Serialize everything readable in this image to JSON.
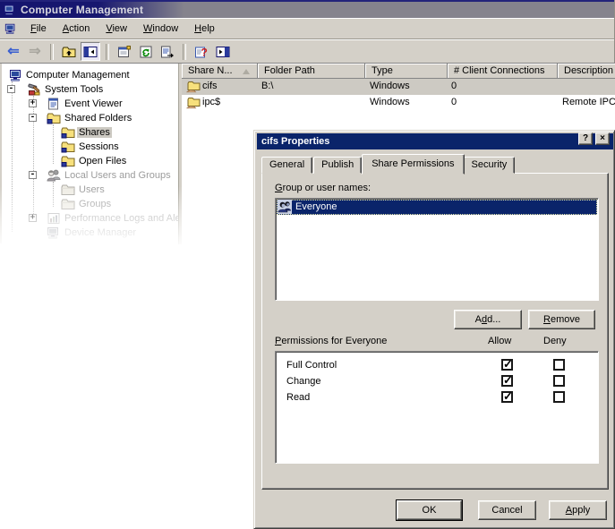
{
  "colors": {
    "accent_navy": "#0a246a",
    "face": "#d4d0c8",
    "title_gradient_left": "#14146e",
    "title_gradient_right": "#85838d",
    "selection_inactive": "#cdcac3"
  },
  "window": {
    "title": "Computer Management",
    "menu": [
      {
        "text": "File",
        "u": 0
      },
      {
        "text": "Action",
        "u": 0
      },
      {
        "text": "View",
        "u": 0
      },
      {
        "text": "Window",
        "u": 0
      },
      {
        "text": "Help",
        "u": 0
      }
    ],
    "toolbar_buttons": [
      "back",
      "forward",
      "up-one-level",
      "show-hide-console-tree",
      "properties",
      "refresh",
      "export-list",
      "help",
      "show-hide-action-pane"
    ]
  },
  "tree": {
    "items": [
      {
        "label": "Computer Management",
        "level": 0,
        "expand": "",
        "icon": "computer"
      },
      {
        "label": "System Tools",
        "level": 1,
        "expand": "-",
        "icon": "system-tools"
      },
      {
        "label": "Event Viewer",
        "level": 2,
        "expand": "+",
        "icon": "event-viewer"
      },
      {
        "label": "Shared Folders",
        "level": 2,
        "expand": "-",
        "icon": "shared-folder"
      },
      {
        "label": "Shares",
        "level": 3,
        "expand": "",
        "icon": "shared-folder",
        "selected": true
      },
      {
        "label": "Sessions",
        "level": 3,
        "expand": "",
        "icon": "shared-folder"
      },
      {
        "label": "Open Files",
        "level": 3,
        "expand": "",
        "icon": "shared-folder"
      },
      {
        "label": "Local Users and Groups",
        "level": 2,
        "expand": "-",
        "icon": "users",
        "grayed": true
      },
      {
        "label": "Users",
        "level": 3,
        "expand": "",
        "icon": "folder",
        "grayed": true
      },
      {
        "label": "Groups",
        "level": 3,
        "expand": "",
        "icon": "folder",
        "grayed": true
      },
      {
        "label": "Performance Logs and Alert:",
        "level": 2,
        "expand": "+",
        "icon": "performance",
        "grayed": true
      },
      {
        "label": "Device Manager",
        "level": 2,
        "expand": "",
        "icon": "computer",
        "grayed": true
      }
    ]
  },
  "list": {
    "columns": [
      {
        "label": "Share N...",
        "sorted": "ascending"
      },
      {
        "label": "Folder Path"
      },
      {
        "label": "Type"
      },
      {
        "label": "# Client Connections"
      },
      {
        "label": "Description"
      }
    ],
    "rows": [
      {
        "name": "cifs",
        "folder_path": "B:\\",
        "type": "Windows",
        "client_connections": "0",
        "description": "",
        "selected": true
      },
      {
        "name": "ipc$",
        "folder_path": "",
        "type": "Windows",
        "client_connections": "0",
        "description": "Remote IPC",
        "selected": false
      }
    ]
  },
  "dialog": {
    "title": "cifs Properties",
    "help_button": "?",
    "close_button": "×",
    "tabs": [
      {
        "label": "General",
        "active": false
      },
      {
        "label": "Publish",
        "active": false
      },
      {
        "label": "Share Permissions",
        "active": true
      },
      {
        "label": "Security",
        "active": false
      }
    ],
    "group_label": {
      "text": "Group or user names:",
      "u": 0
    },
    "groups": [
      {
        "name": "Everyone",
        "selected": true
      }
    ],
    "add_button": {
      "text": "Add...",
      "u": 1
    },
    "remove_button": {
      "text": "Remove",
      "u": 0
    },
    "permissions": {
      "label": {
        "text": "Permissions for Everyone",
        "u": 0
      },
      "allow_header": "Allow",
      "deny_header": "Deny",
      "rows": [
        {
          "name": "Full Control",
          "allow": true,
          "deny": false
        },
        {
          "name": "Change",
          "allow": true,
          "deny": false
        },
        {
          "name": "Read",
          "allow": true,
          "deny": false
        }
      ]
    },
    "footer": {
      "ok": {
        "text": "OK",
        "u": -1
      },
      "cancel": {
        "text": "Cancel",
        "u": -1
      },
      "apply": {
        "text": "Apply",
        "u": 0
      }
    }
  }
}
